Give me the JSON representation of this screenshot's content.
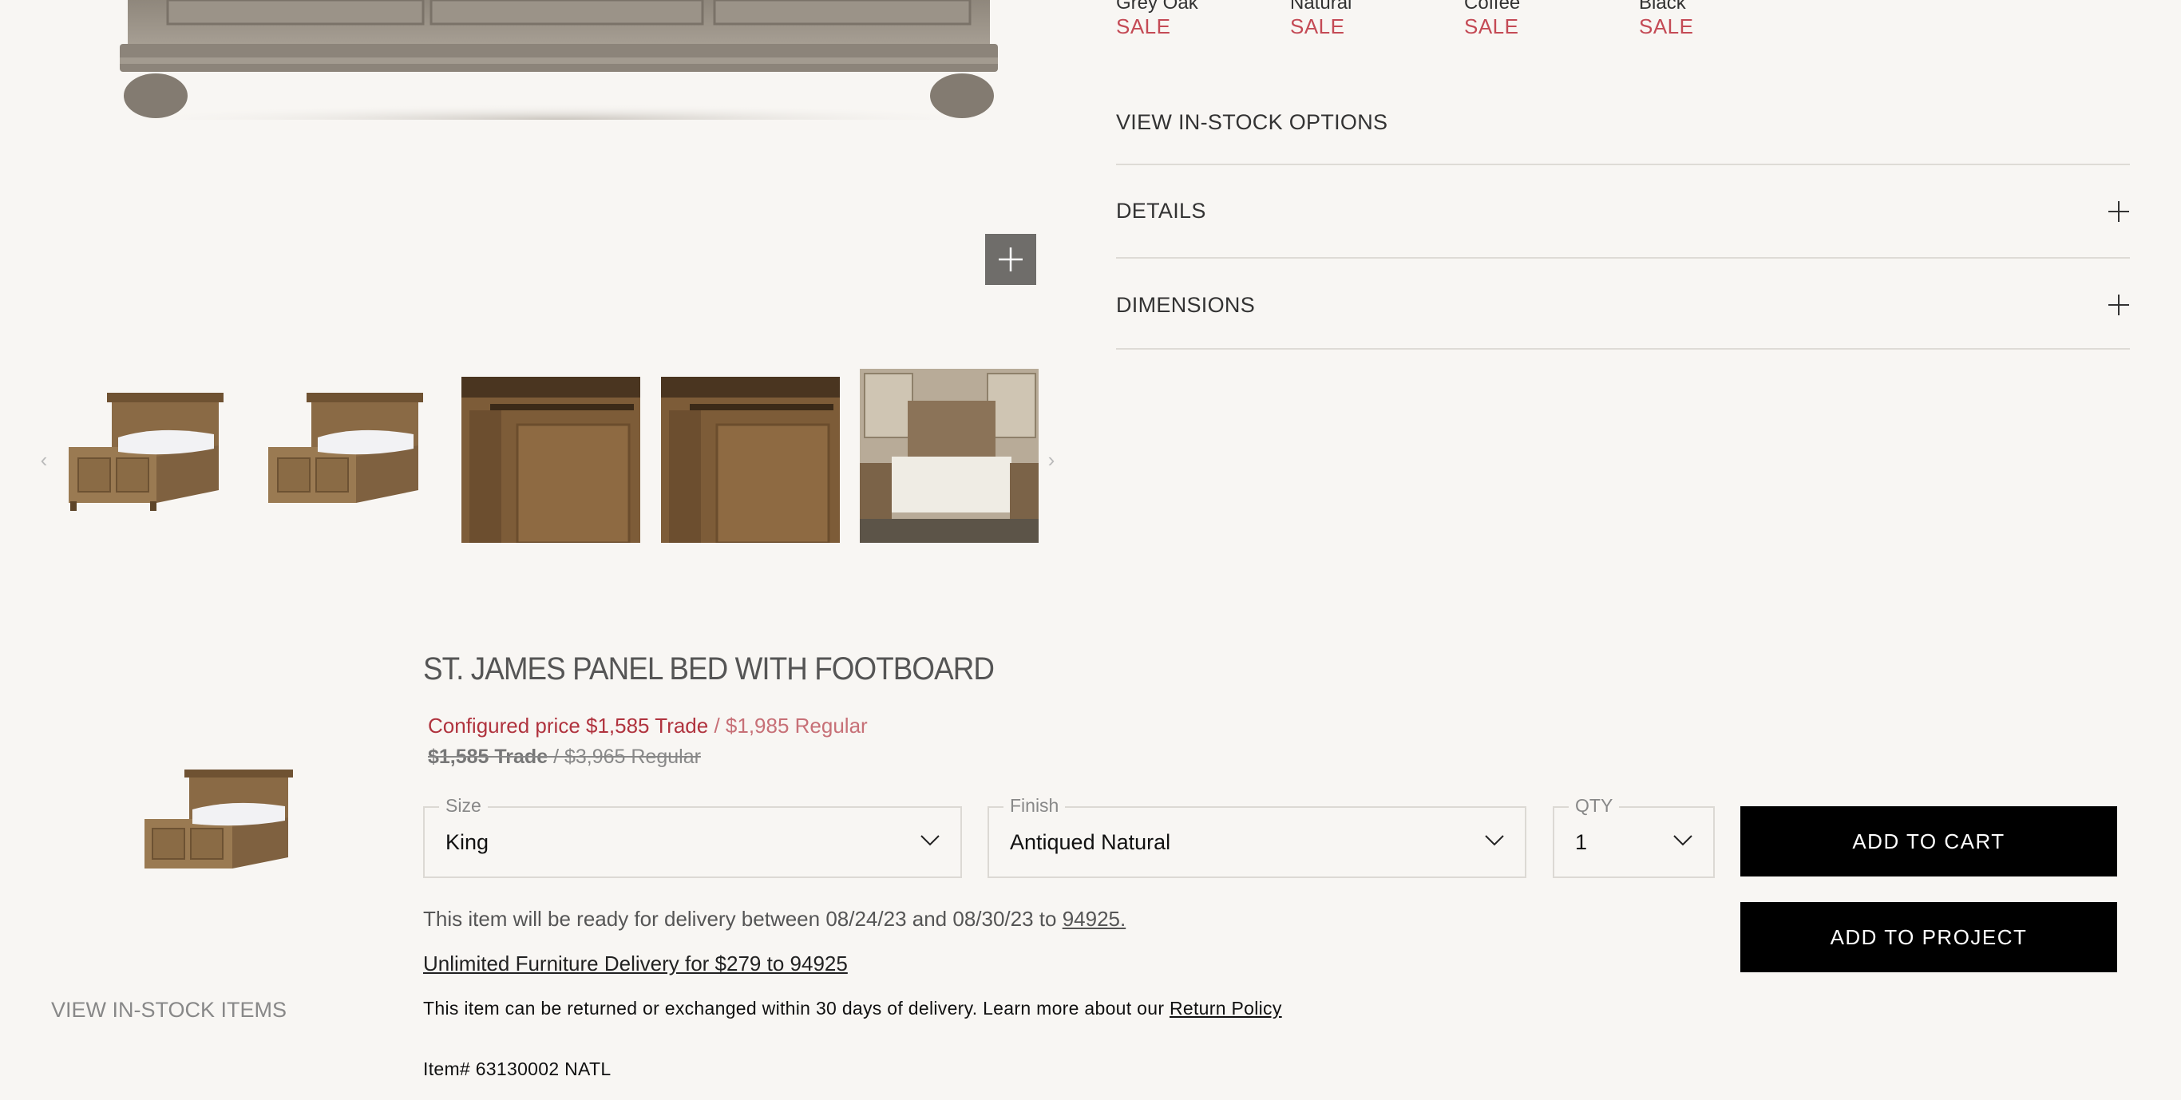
{
  "swatches": [
    {
      "name": "Grey Oak",
      "badge": "SALE"
    },
    {
      "name": "Natural",
      "badge": "SALE"
    },
    {
      "name": "Coffee",
      "badge": "SALE"
    },
    {
      "name": "Black",
      "badge": "SALE"
    }
  ],
  "accordion": {
    "view_in_stock_options": "VIEW IN-STOCK OPTIONS",
    "details": "DETAILS",
    "dimensions": "DIMENSIONS"
  },
  "product": {
    "title": "ST. JAMES PANEL BED WITH FOOTBOARD",
    "configured_price": "Configured price $1,585 Trade",
    "configured_regular": " / $1,985 Regular",
    "original_trade": "$1,585 Trade",
    "original_regular": " / $3,965 Regular",
    "size": {
      "label": "Size",
      "value": "King"
    },
    "finish": {
      "label": "Finish",
      "value": "Antiqued Natural"
    },
    "qty": {
      "label": "QTY",
      "value": "1"
    },
    "add_to_cart": "ADD TO CART",
    "add_to_project": "ADD TO PROJECT",
    "delivery_text": "This item will be ready for delivery between 08/24/23 and 08/30/23 to ",
    "delivery_zip": "94925.",
    "unlimited_delivery": "Unlimited Furniture Delivery for $279 to 94925",
    "returns_text": "This item can be returned or exchanged within 30 days of delivery.  Learn more about our ",
    "returns_link": "Return Policy",
    "item_number": "Item# 63130002 NATL"
  },
  "sidebar": {
    "view_in_stock_items": "VIEW IN-STOCK ITEMS"
  },
  "colors": {
    "sale_red": "#c44a55",
    "price_red": "#b0333e",
    "background": "#f8f6f3"
  }
}
